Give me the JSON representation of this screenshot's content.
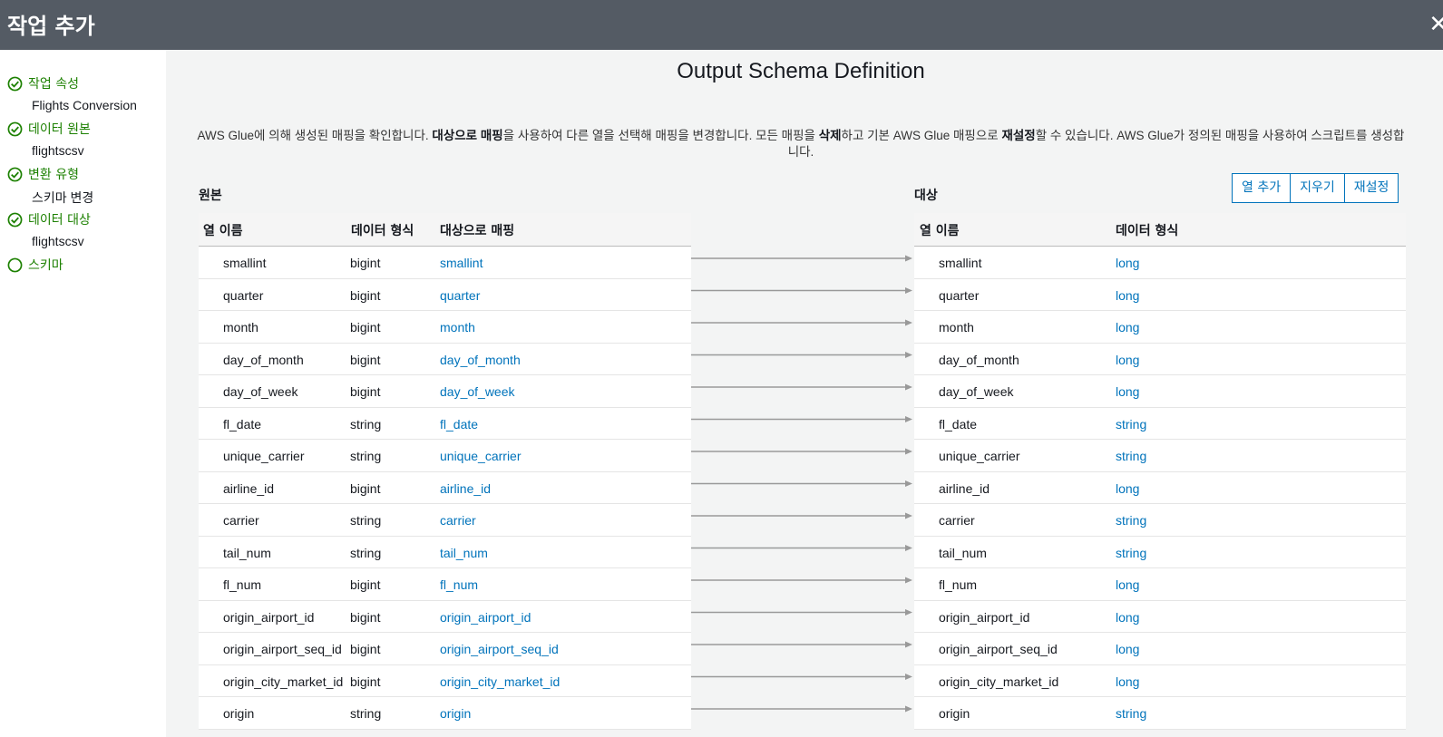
{
  "header": {
    "title": "작업 추가",
    "close_icon": "close-icon"
  },
  "sidebar": {
    "steps": [
      {
        "label": "작업 속성",
        "value": "Flights Conversion",
        "status": "complete"
      },
      {
        "label": "데이터 원본",
        "value": "flightscsv",
        "status": "complete"
      },
      {
        "label": "변환 유형",
        "value": "스키마 변경",
        "status": "complete"
      },
      {
        "label": "데이터 대상",
        "value": "flightscsv",
        "status": "complete"
      },
      {
        "label": "스키마",
        "value": "",
        "status": "current"
      }
    ]
  },
  "main": {
    "title": "Output Schema Definition",
    "description": {
      "p1": "AWS Glue에 의해 생성된 매핑을 확인합니다. ",
      "b1": "대상으로 매핑",
      "p2": "을 사용하여 다른 열을 선택해 매핑을 변경합니다. 모든 매핑을 ",
      "b2": "삭제",
      "p3": "하고 기본 AWS Glue 매핑으로 ",
      "b3": "재설정",
      "p4": "할 수 있습니다. AWS Glue가 정의된 매핑을 사용하여 스크립트를 생성합니다."
    },
    "source_label": "원본",
    "target_label": "대상",
    "buttons": {
      "add_column": "열 추가",
      "clear": "지우기",
      "reset": "재설정"
    },
    "source_headers": {
      "name": "열 이름",
      "type": "데이터 형식",
      "map": "대상으로 매핑"
    },
    "target_headers": {
      "name": "열 이름",
      "type": "데이터 형식"
    },
    "rows": [
      {
        "src": "smallint",
        "src_type": "bigint",
        "map": "smallint",
        "tgt": "smallint",
        "tgt_type": "long"
      },
      {
        "src": "quarter",
        "src_type": "bigint",
        "map": "quarter",
        "tgt": "quarter",
        "tgt_type": "long"
      },
      {
        "src": "month",
        "src_type": "bigint",
        "map": "month",
        "tgt": "month",
        "tgt_type": "long"
      },
      {
        "src": "day_of_month",
        "src_type": "bigint",
        "map": "day_of_month",
        "tgt": "day_of_month",
        "tgt_type": "long"
      },
      {
        "src": "day_of_week",
        "src_type": "bigint",
        "map": "day_of_week",
        "tgt": "day_of_week",
        "tgt_type": "long"
      },
      {
        "src": "fl_date",
        "src_type": "string",
        "map": "fl_date",
        "tgt": "fl_date",
        "tgt_type": "string"
      },
      {
        "src": "unique_carrier",
        "src_type": "string",
        "map": "unique_carrier",
        "tgt": "unique_carrier",
        "tgt_type": "string"
      },
      {
        "src": "airline_id",
        "src_type": "bigint",
        "map": "airline_id",
        "tgt": "airline_id",
        "tgt_type": "long"
      },
      {
        "src": "carrier",
        "src_type": "string",
        "map": "carrier",
        "tgt": "carrier",
        "tgt_type": "string"
      },
      {
        "src": "tail_num",
        "src_type": "string",
        "map": "tail_num",
        "tgt": "tail_num",
        "tgt_type": "string"
      },
      {
        "src": "fl_num",
        "src_type": "bigint",
        "map": "fl_num",
        "tgt": "fl_num",
        "tgt_type": "long"
      },
      {
        "src": "origin_airport_id",
        "src_type": "bigint",
        "map": "origin_airport_id",
        "tgt": "origin_airport_id",
        "tgt_type": "long"
      },
      {
        "src": "origin_airport_seq_id",
        "src_type": "bigint",
        "map": "origin_airport_seq_id",
        "tgt": "origin_airport_seq_id",
        "tgt_type": "long"
      },
      {
        "src": "origin_city_market_id",
        "src_type": "bigint",
        "map": "origin_city_market_id",
        "tgt": "origin_city_market_id",
        "tgt_type": "long"
      },
      {
        "src": "origin",
        "src_type": "string",
        "map": "origin",
        "tgt": "origin",
        "tgt_type": "string"
      }
    ]
  },
  "colors": {
    "header_bg": "#545b64",
    "success": "#1d8102",
    "link": "#0073bb",
    "arrow": "#999999"
  }
}
